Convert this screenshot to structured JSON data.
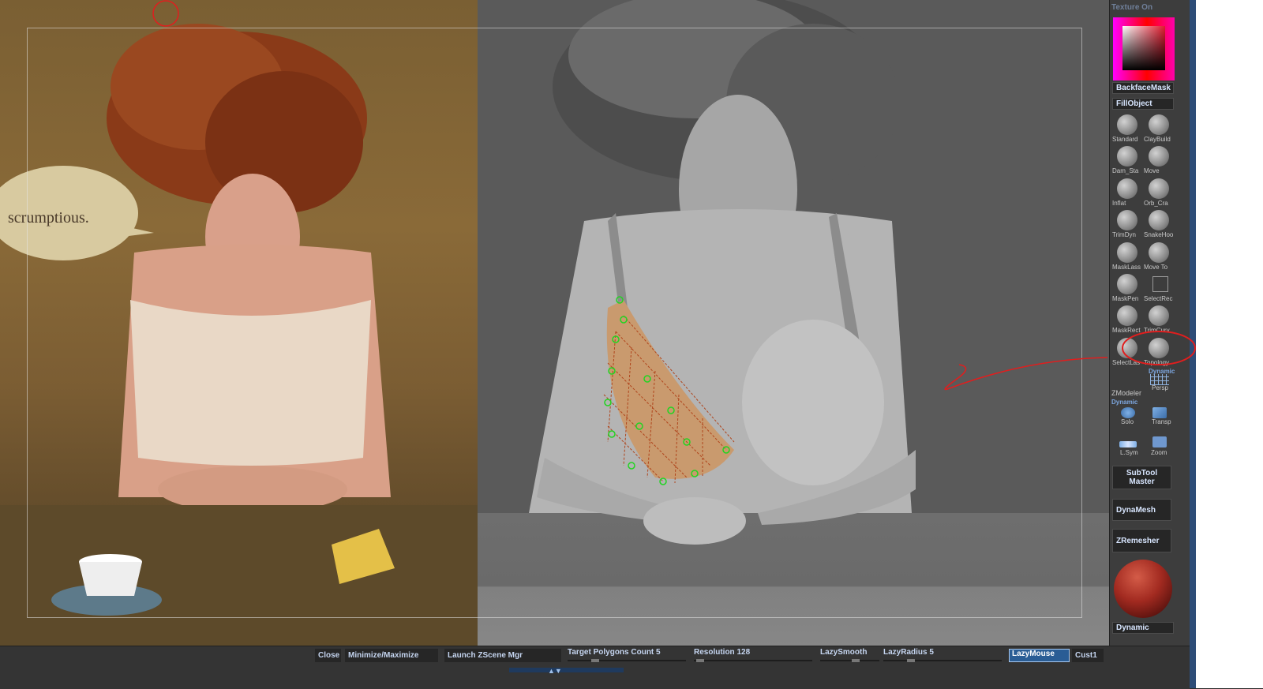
{
  "texture_label": "Texture On",
  "panel": {
    "backface_mask": "BackfaceMask",
    "fill_object": "FillObject",
    "brushes": [
      {
        "label": "Standard"
      },
      {
        "label": "ClayBuild"
      },
      {
        "label": "Dam_Sta"
      },
      {
        "label": "Move"
      },
      {
        "label": "Inflat"
      },
      {
        "label": "Orb_Cra"
      },
      {
        "label": "TrimDyn"
      },
      {
        "label": "SnakeHoo"
      },
      {
        "label": "MaskLass"
      },
      {
        "label": "Move To"
      },
      {
        "label": "MaskPen"
      },
      {
        "label": "SelectRec"
      },
      {
        "label": "MaskRect"
      },
      {
        "label": "TrimCurv"
      },
      {
        "label": "SelectLas"
      },
      {
        "label": "Topology"
      }
    ],
    "dynamic_small": "Dynamic",
    "persp": "Persp",
    "zmodeler": "ZModeler",
    "dynamic_label": "Dynamic",
    "solo": "Solo",
    "transp": "Transp",
    "lsym": "L.Sym",
    "zoom": "Zoom",
    "subtool_master_1": "SubTool",
    "subtool_master_2": "Master",
    "dynamesh": "DynaMesh",
    "zremesher": "ZRemesher",
    "dynamic_bottom": "Dynamic"
  },
  "reference": {
    "speech_text": "scrumptious."
  },
  "bottom_bar": {
    "close": "Close",
    "minimize": "Minimize/Maximize",
    "launch": "Launch ZScene Mgr",
    "target_polygons": "Target Polygons Count 5",
    "resolution": "Resolution 128",
    "lazysmooth": "LazySmooth",
    "lazyradius": "LazyRadius 5",
    "lazymouse": "LazyMouse",
    "cust1": "Cust1"
  },
  "colors": {
    "accent": "#2a5d95",
    "annotation": "#e01e1e",
    "topology_green": "#22d422"
  }
}
